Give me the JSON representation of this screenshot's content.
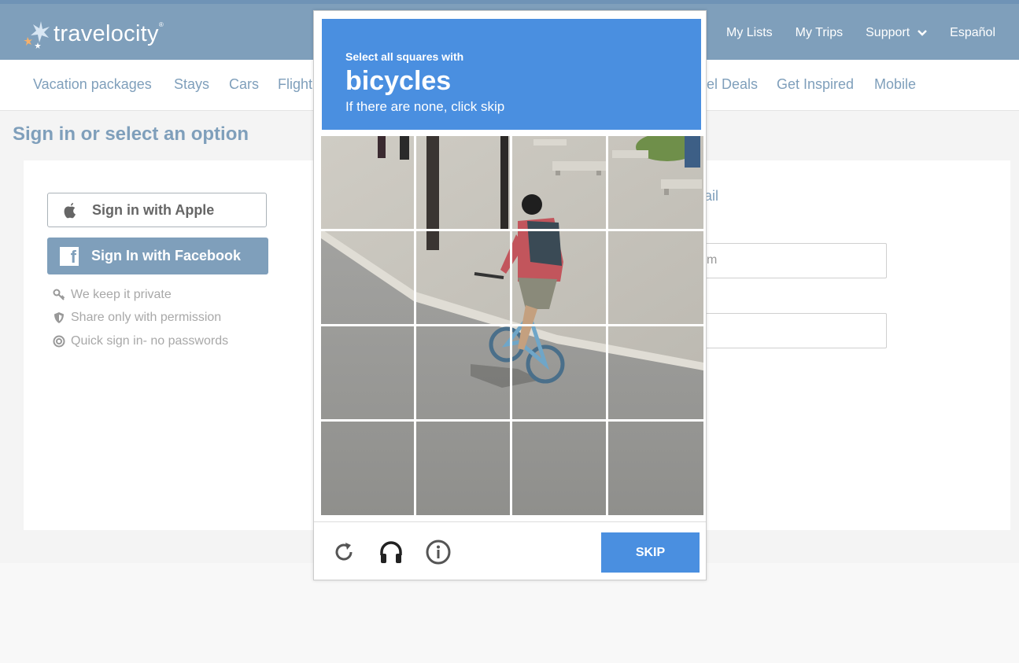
{
  "header": {
    "logo_text": "travelocity",
    "logo_mark": "®",
    "top_links": [
      "My Lists",
      "My Trips",
      "Support",
      "Español"
    ]
  },
  "subnav": {
    "links": [
      "Vacation packages",
      "Stays",
      "Cars",
      "Flight",
      "el Deals",
      "Get Inspired",
      "Mobile"
    ]
  },
  "page": {
    "title": "Sign in or select an option",
    "apple_button": "Sign in with Apple",
    "facebook_button": "Sign In with Facebook",
    "facebook_icon": "f",
    "perks": [
      "We keep it private",
      "Share only with permission",
      "Quick sign in- no passwords"
    ],
    "partial_email_label": "ail",
    "partial_email_value": "m"
  },
  "captcha": {
    "instruction": "Select all squares with",
    "target": "bicycles",
    "hint": "If there are none, click skip",
    "skip_label": "SKIP",
    "icons": [
      "reload-icon",
      "headphones-icon",
      "info-icon"
    ]
  },
  "colors": {
    "brand": "#7f9fbb",
    "captcha_blue": "#4a8fe0"
  }
}
